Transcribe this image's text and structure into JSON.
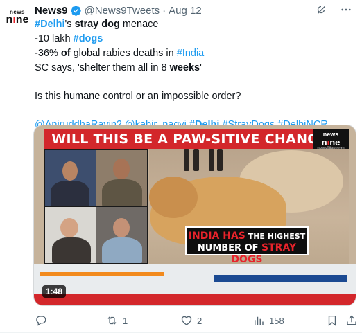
{
  "author": {
    "avatar_text_top": "news",
    "avatar_text_bottom_pre": "n",
    "avatar_text_bottom_o": "ı",
    "avatar_text_bottom_post": "ne",
    "name": "News9",
    "handle": "@News9Tweets",
    "separator": "·",
    "date": "Aug 12"
  },
  "icons": {
    "verified": "verified-badge-icon",
    "grok": "grok-icon",
    "more": "more-icon",
    "reply": "reply-icon",
    "retweet": "retweet-icon",
    "like": "like-icon",
    "views": "views-icon",
    "bookmark": "bookmark-icon",
    "share": "share-icon"
  },
  "tweet": {
    "l1_tag": "#Delhi",
    "l1_a": "'s ",
    "l1_b": "stray dog",
    "l1_c": " menace",
    "l2_a": "-10 lakh ",
    "l2_tag": "#dogs",
    "l3_a": "-36% ",
    "l3_b": "of",
    "l3_c": " global rabies deaths in ",
    "l3_tag": "#India",
    "l4_a": "SC says, 'shelter them all in 8 ",
    "l4_b": "weeks",
    "l4_c": "'",
    "question": "Is this humane control or an impossible order?",
    "mention1": "@AniruddhaRavin2",
    "mention2": "@kabir_naqvi",
    "tag_delhi": "#Delhi",
    "tag_stray": "#StrayDogs",
    "tag_ncr": "#DelhiNCR"
  },
  "video": {
    "banner": "WILL THIS BE A PAW-SITIVE CHANGE?",
    "logo_top": "news",
    "logo_mid_pre": "n",
    "logo_mid_o": "ı",
    "logo_mid_post": "ne",
    "logo_url": "news9live.com",
    "lower_red1": "INDIA HAS",
    "lower_white1": " THE HIGHEST",
    "lower_white2": "NUMBER OF ",
    "lower_red2": "STRAY DOGS",
    "duration": "1:48"
  },
  "stats": {
    "replies": "",
    "retweets": "1",
    "likes": "2",
    "views": "158"
  },
  "colors": {
    "link": "#1d9bf0",
    "muted": "#536471",
    "banner_red": "#d3272b"
  }
}
